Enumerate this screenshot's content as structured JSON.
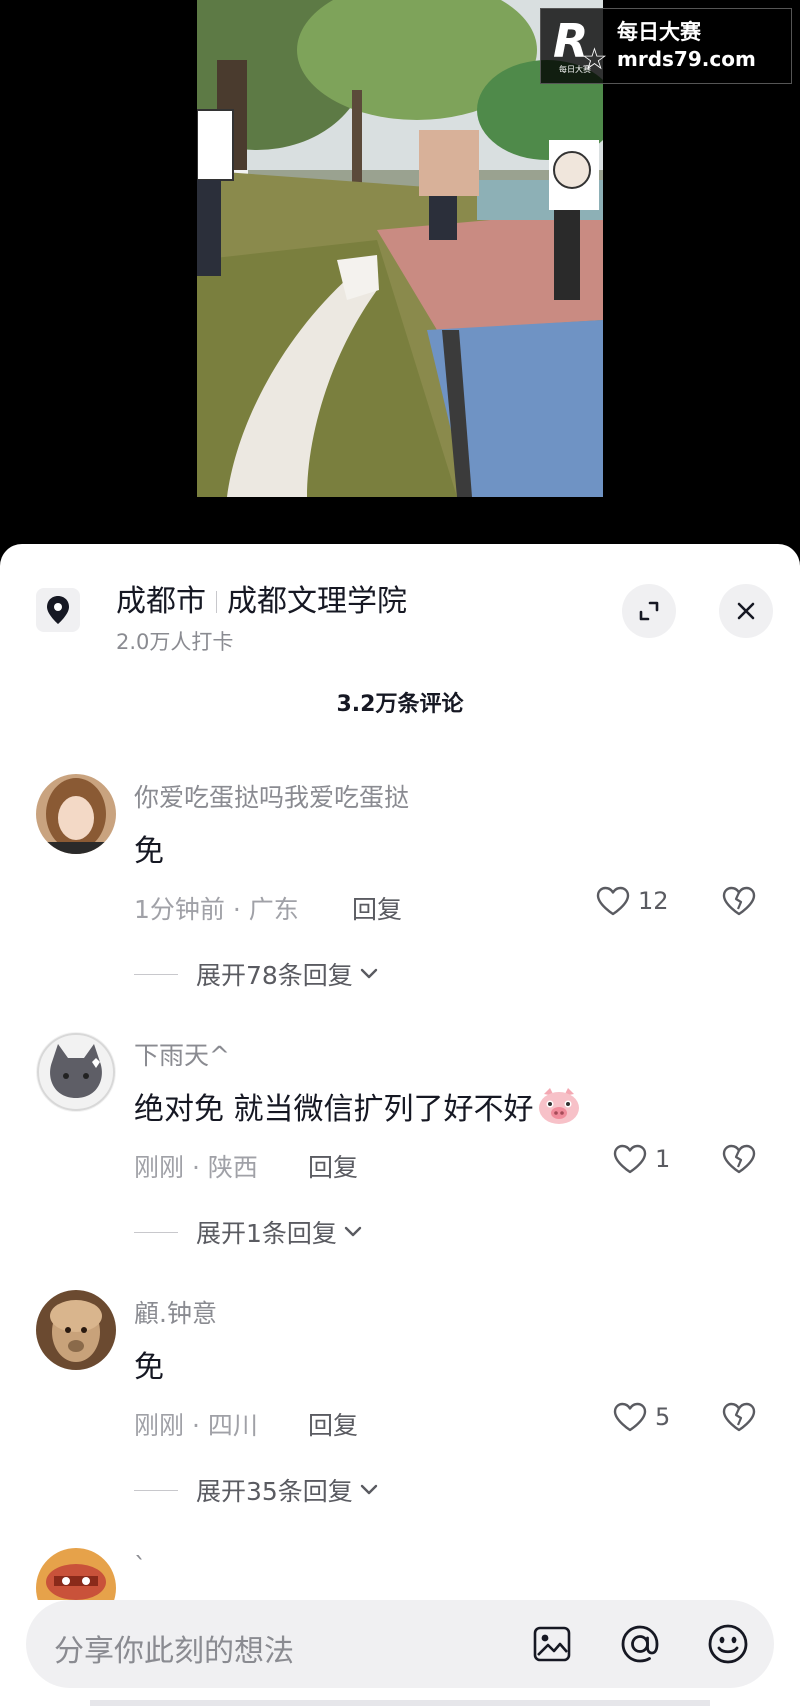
{
  "watermark": {
    "logo_letter": "R",
    "logo_sub": "每日大赛",
    "line1": "每日大赛",
    "line2": "mrds79.com"
  },
  "location": {
    "city": "成都市",
    "place": "成都文理学院",
    "checkins": "2.0万人打卡"
  },
  "comments_header": {
    "count_label": "3.2万条评论"
  },
  "comments": [
    {
      "user": "你爱吃蛋挞吗我爱吃蛋挞",
      "text": "免",
      "meta": "1分钟前 · 广东",
      "reply": "回复",
      "likes": "12",
      "expand": "展开78条回复"
    },
    {
      "user": "下雨天^",
      "text": "绝对免 就当微信扩列了好不好",
      "meta": "刚刚 · 陕西",
      "reply": "回复",
      "likes": "1",
      "expand": "展开1条回复"
    },
    {
      "user": "顧.钟意",
      "text": "免",
      "meta": "刚刚 · 四川",
      "reply": "回复",
      "likes": "5",
      "expand": "展开35条回复"
    },
    {
      "user": "`"
    }
  ],
  "input_bar": {
    "placeholder": "分享你此刻的想法"
  },
  "colors": {
    "sheet_bg": "#ffffff",
    "primary_text": "#161823",
    "secondary_text": "#8a8b91",
    "pill_bg": "#f0f0f2"
  }
}
